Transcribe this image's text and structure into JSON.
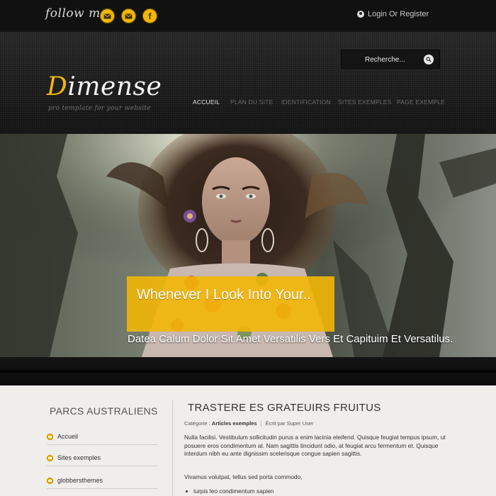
{
  "topbar": {
    "follow_label": "follow me:",
    "social_icons": [
      "mail-icon",
      "mail-icon",
      "facebook-icon"
    ],
    "facebook_glyph": "f",
    "login_label": "Login Or Register"
  },
  "header": {
    "search_placeholder": "Recherche...",
    "logo_initial": "D",
    "logo_rest": "imense",
    "tagline": "pro template for your website",
    "nav": [
      "ACCUEIL",
      "PLAN DU SITE",
      "IDENTIFICATION",
      "SITES EXEMPLES",
      "PAGE EXEMPLE"
    ],
    "active_nav": "ACCUEIL"
  },
  "hero": {
    "caption_title": "Whenever I Look Into Your..",
    "caption_subtitle": "Datea Calum Dolor Sit Amet Versatilis Vers Et Capituim Et Versatilus."
  },
  "sidebar": {
    "title": "PARCS AUSTRALIENS",
    "items": [
      "Accueil",
      "Sites exemples",
      "globbersthemes"
    ]
  },
  "article": {
    "title": "TRASTERE ES GRATEUIRS FRUITUS",
    "category_label": "Catégorie : ",
    "category_value": "Articles exemples",
    "author_label": "Écrit par ",
    "author_value": "Super User",
    "paragraph1": "Nulla facilisi. Vestibulum sollicitudin purus a enim lacinia eleifend. Quisque feugiat tempus ipsum, ut posuere eros condimentum at. Nam sagittis tincidunt odio, at feugiat arcu fermentum et. Quisque interdum nibh eu ante dignissim scelerisque congue sapien sagittis.",
    "paragraph2": "Vivamus volutpat, tellus sed porta commodo,",
    "list_item": "turpis leo condimentum sapien"
  },
  "colors": {
    "accent": "#f2b705",
    "header_bg": "#1f1f1f",
    "content_bg": "#efeeeb"
  }
}
